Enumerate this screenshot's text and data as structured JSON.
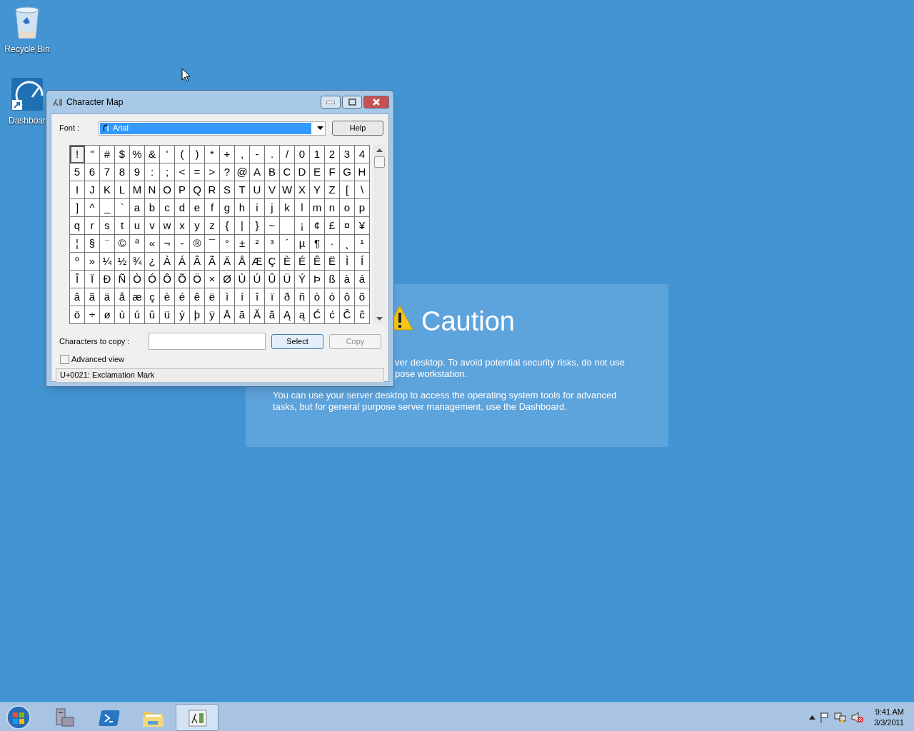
{
  "desktop_icons": [
    {
      "label": "Recycle Bin",
      "kind": "bin"
    },
    {
      "label": "Dashboar",
      "kind": "dashboard"
    }
  ],
  "caution": {
    "title": "Caution",
    "lines": [
      "ver desktop. To avoid potential security risks, do not use",
      "pose workstation."
    ],
    "paragraph": "You can use your server desktop to access the operating system tools for advanced tasks, but for general purpose server management, use the Dashboard."
  },
  "window": {
    "title": "Character Map",
    "font_label": "Font :",
    "font_value": "Arial",
    "help": "Help",
    "grid": [
      [
        {
          "c": "!",
          "selected": true
        },
        {
          "c": "\"",
          "selected": false
        },
        {
          "c": "#",
          "selected": false
        },
        {
          "c": "$",
          "selected": false
        },
        {
          "c": "%",
          "selected": false
        },
        {
          "c": "&",
          "selected": false
        },
        {
          "c": "'",
          "selected": false
        },
        {
          "c": "(",
          "selected": false
        },
        {
          "c": ")",
          "selected": false
        },
        {
          "c": "*",
          "selected": false
        },
        {
          "c": "+",
          "selected": false
        },
        {
          "c": ",",
          "selected": false
        },
        {
          "c": "-",
          "selected": false
        },
        {
          "c": ".",
          "selected": false
        },
        {
          "c": "/",
          "selected": false
        },
        {
          "c": "0",
          "selected": false
        },
        {
          "c": "1",
          "selected": false
        },
        {
          "c": "2",
          "selected": false
        },
        {
          "c": "3",
          "selected": false
        },
        {
          "c": "4",
          "selected": false
        }
      ],
      [
        {
          "c": "5",
          "selected": false
        },
        {
          "c": "6",
          "selected": false
        },
        {
          "c": "7",
          "selected": false
        },
        {
          "c": "8",
          "selected": false
        },
        {
          "c": "9",
          "selected": false
        },
        {
          "c": ":",
          "selected": false
        },
        {
          "c": ";",
          "selected": false
        },
        {
          "c": "<",
          "selected": false
        },
        {
          "c": "=",
          "selected": false
        },
        {
          "c": ">",
          "selected": false
        },
        {
          "c": "?",
          "selected": false
        },
        {
          "c": "@",
          "selected": false
        },
        {
          "c": "A",
          "selected": false
        },
        {
          "c": "B",
          "selected": false
        },
        {
          "c": "C",
          "selected": false
        },
        {
          "c": "D",
          "selected": false
        },
        {
          "c": "E",
          "selected": false
        },
        {
          "c": "F",
          "selected": false
        },
        {
          "c": "G",
          "selected": false
        },
        {
          "c": "H",
          "selected": false
        }
      ],
      [
        {
          "c": "I",
          "selected": false
        },
        {
          "c": "J",
          "selected": false
        },
        {
          "c": "K",
          "selected": false
        },
        {
          "c": "L",
          "selected": false
        },
        {
          "c": "M",
          "selected": false
        },
        {
          "c": "N",
          "selected": false
        },
        {
          "c": "O",
          "selected": false
        },
        {
          "c": "P",
          "selected": false
        },
        {
          "c": "Q",
          "selected": false
        },
        {
          "c": "R",
          "selected": false
        },
        {
          "c": "S",
          "selected": false
        },
        {
          "c": "T",
          "selected": false
        },
        {
          "c": "U",
          "selected": false
        },
        {
          "c": "V",
          "selected": false
        },
        {
          "c": "W",
          "selected": false
        },
        {
          "c": "X",
          "selected": false
        },
        {
          "c": "Y",
          "selected": false
        },
        {
          "c": "Z",
          "selected": false
        },
        {
          "c": "[",
          "selected": false
        },
        {
          "c": "\\",
          "selected": false
        }
      ],
      [
        {
          "c": "]",
          "selected": false
        },
        {
          "c": "^",
          "selected": false
        },
        {
          "c": "_",
          "selected": false
        },
        {
          "c": "`",
          "selected": false
        },
        {
          "c": "a",
          "selected": false
        },
        {
          "c": "b",
          "selected": false
        },
        {
          "c": "c",
          "selected": false
        },
        {
          "c": "d",
          "selected": false
        },
        {
          "c": "e",
          "selected": false
        },
        {
          "c": "f",
          "selected": false
        },
        {
          "c": "g",
          "selected": false
        },
        {
          "c": "h",
          "selected": false
        },
        {
          "c": "i",
          "selected": false
        },
        {
          "c": "j",
          "selected": false
        },
        {
          "c": "k",
          "selected": false
        },
        {
          "c": "l",
          "selected": false
        },
        {
          "c": "m",
          "selected": false
        },
        {
          "c": "n",
          "selected": false
        },
        {
          "c": "o",
          "selected": false
        },
        {
          "c": "p",
          "selected": false
        }
      ],
      [
        {
          "c": "q",
          "selected": false
        },
        {
          "c": "r",
          "selected": false
        },
        {
          "c": "s",
          "selected": false
        },
        {
          "c": "t",
          "selected": false
        },
        {
          "c": "u",
          "selected": false
        },
        {
          "c": "v",
          "selected": false
        },
        {
          "c": "w",
          "selected": false
        },
        {
          "c": "x",
          "selected": false
        },
        {
          "c": "y",
          "selected": false
        },
        {
          "c": "z",
          "selected": false
        },
        {
          "c": "{",
          "selected": false
        },
        {
          "c": "|",
          "selected": false
        },
        {
          "c": "}",
          "selected": false
        },
        {
          "c": "~",
          "selected": false
        },
        {
          "selected": false
        },
        {
          "c": "¡",
          "selected": false
        },
        {
          "c": "¢",
          "selected": false
        },
        {
          "c": "£",
          "selected": false
        },
        {
          "c": "¤",
          "selected": false
        },
        {
          "c": "¥",
          "selected": false
        }
      ],
      [
        {
          "c": "¦",
          "selected": false
        },
        {
          "c": "§",
          "selected": false
        },
        {
          "c": "¨",
          "selected": false
        },
        {
          "c": "©",
          "selected": false
        },
        {
          "c": "ª",
          "selected": false
        },
        {
          "c": "«",
          "selected": false
        },
        {
          "c": "¬",
          "selected": false
        },
        {
          "c": "-",
          "selected": false
        },
        {
          "c": "®",
          "selected": false
        },
        {
          "c": "¯",
          "selected": false
        },
        {
          "c": "°",
          "selected": false
        },
        {
          "c": "±",
          "selected": false
        },
        {
          "c": "²",
          "selected": false
        },
        {
          "c": "³",
          "selected": false
        },
        {
          "c": "´",
          "selected": false
        },
        {
          "c": "µ",
          "selected": false
        },
        {
          "c": "¶",
          "selected": false
        },
        {
          "c": "·",
          "selected": false
        },
        {
          "c": "¸",
          "selected": false
        },
        {
          "c": "¹",
          "selected": false
        }
      ],
      [
        {
          "c": "º",
          "selected": false
        },
        {
          "c": "»",
          "selected": false
        },
        {
          "c": "¼",
          "selected": false
        },
        {
          "c": "½",
          "selected": false
        },
        {
          "c": "¾",
          "selected": false
        },
        {
          "c": "¿",
          "selected": false
        },
        {
          "c": "À",
          "selected": false
        },
        {
          "c": "Á",
          "selected": false
        },
        {
          "c": "Â",
          "selected": false
        },
        {
          "c": "Ã",
          "selected": false
        },
        {
          "c": "Ä",
          "selected": false
        },
        {
          "c": "Å",
          "selected": false
        },
        {
          "c": "Æ",
          "selected": false
        },
        {
          "c": "Ç",
          "selected": false
        },
        {
          "c": "È",
          "selected": false
        },
        {
          "c": "É",
          "selected": false
        },
        {
          "c": "Ê",
          "selected": false
        },
        {
          "c": "Ë",
          "selected": false
        },
        {
          "c": "Ì",
          "selected": false
        },
        {
          "c": "Í",
          "selected": false
        }
      ],
      [
        {
          "c": "Î",
          "selected": false
        },
        {
          "c": "Ï",
          "selected": false
        },
        {
          "c": "Ð",
          "selected": false
        },
        {
          "c": "Ñ",
          "selected": false
        },
        {
          "c": "Ò",
          "selected": false
        },
        {
          "c": "Ó",
          "selected": false
        },
        {
          "c": "Ô",
          "selected": false
        },
        {
          "c": "Õ",
          "selected": false
        },
        {
          "c": "Ö",
          "selected": false
        },
        {
          "c": "×",
          "selected": false
        },
        {
          "c": "Ø",
          "selected": false
        },
        {
          "c": "Ù",
          "selected": false
        },
        {
          "c": "Ú",
          "selected": false
        },
        {
          "c": "Û",
          "selected": false
        },
        {
          "c": "Ü",
          "selected": false
        },
        {
          "c": "Ý",
          "selected": false
        },
        {
          "c": "Þ",
          "selected": false
        },
        {
          "c": "ß",
          "selected": false
        },
        {
          "c": "à",
          "selected": false
        },
        {
          "c": "á",
          "selected": false
        }
      ],
      [
        {
          "c": "â",
          "selected": false
        },
        {
          "c": "ã",
          "selected": false
        },
        {
          "c": "ä",
          "selected": false
        },
        {
          "c": "å",
          "selected": false
        },
        {
          "c": "æ",
          "selected": false
        },
        {
          "c": "ç",
          "selected": false
        },
        {
          "c": "è",
          "selected": false
        },
        {
          "c": "é",
          "selected": false
        },
        {
          "c": "ê",
          "selected": false
        },
        {
          "c": "ë",
          "selected": false
        },
        {
          "c": "ì",
          "selected": false
        },
        {
          "c": "í",
          "selected": false
        },
        {
          "c": "î",
          "selected": false
        },
        {
          "c": "ï",
          "selected": false
        },
        {
          "c": "ð",
          "selected": false
        },
        {
          "c": "ñ",
          "selected": false
        },
        {
          "c": "ò",
          "selected": false
        },
        {
          "c": "ó",
          "selected": false
        },
        {
          "c": "ô",
          "selected": false
        },
        {
          "c": "õ",
          "selected": false
        }
      ],
      [
        {
          "c": "ö",
          "selected": false
        },
        {
          "c": "÷",
          "selected": false
        },
        {
          "c": "ø",
          "selected": false
        },
        {
          "c": "ù",
          "selected": false
        },
        {
          "c": "ú",
          "selected": false
        },
        {
          "c": "û",
          "selected": false
        },
        {
          "c": "ü",
          "selected": false
        },
        {
          "c": "ý",
          "selected": false
        },
        {
          "c": "þ",
          "selected": false
        },
        {
          "c": "ÿ",
          "selected": false
        },
        {
          "c": "Ā",
          "selected": false
        },
        {
          "c": "ā",
          "selected": false
        },
        {
          "c": "Ă",
          "selected": false
        },
        {
          "c": "ă",
          "selected": false
        },
        {
          "c": "Ą",
          "selected": false
        },
        {
          "c": "ą",
          "selected": false
        },
        {
          "c": "Ć",
          "selected": false
        },
        {
          "c": "ć",
          "selected": false
        },
        {
          "c": "Ĉ",
          "selected": false
        },
        {
          "c": "ĉ",
          "selected": false
        }
      ]
    ],
    "copy_label": "Characters to copy :",
    "select": "Select",
    "copy": {
      "label": "Copy",
      "disabled": true
    },
    "advanced_view": {
      "label": "Advanced view",
      "checked": false
    },
    "status": "U+0021: Exclamation Mark"
  },
  "taskbar": {
    "items": [
      {
        "kind": "server",
        "selected": false
      },
      {
        "kind": "shell",
        "selected": false
      },
      {
        "kind": "folder",
        "selected": false
      },
      {
        "kind": "charmap",
        "selected": true
      }
    ],
    "time": "9:41 AM",
    "date": "3/3/2011"
  }
}
